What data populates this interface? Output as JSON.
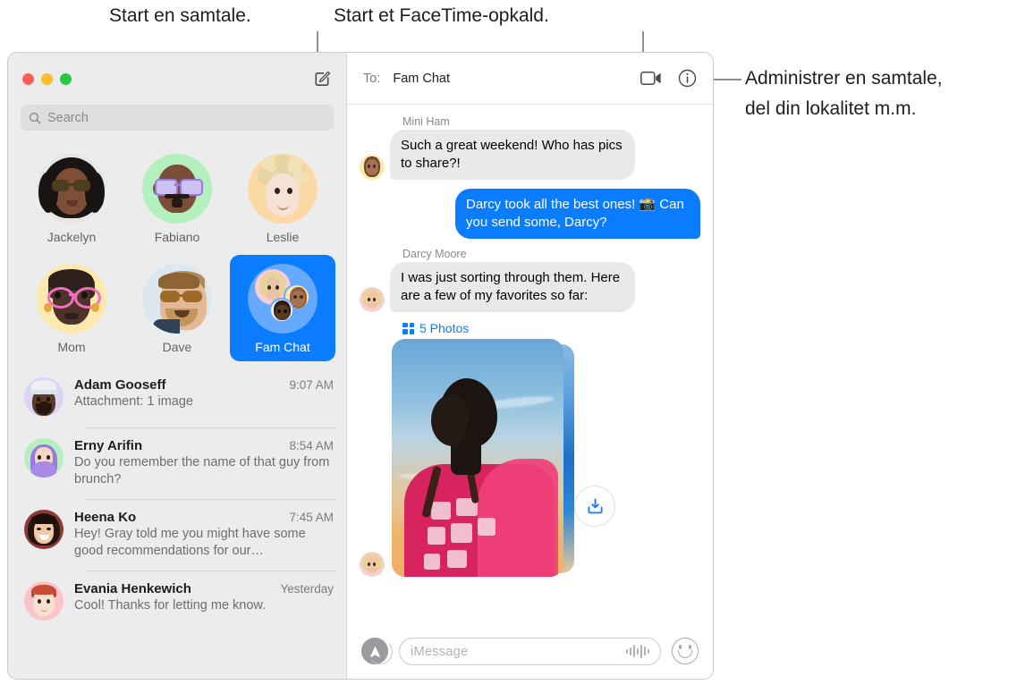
{
  "callouts": [
    {
      "id": "compose",
      "text": "Start en samtale."
    },
    {
      "id": "facetime",
      "text": "Start et FaceTime-opkald."
    },
    {
      "id": "details",
      "line1": "Administrer en samtale,",
      "line2": "del din lokalitet m.m."
    }
  ],
  "window": {
    "traffic_lights": [
      "close",
      "minimize",
      "zoom"
    ],
    "compose_icon": "compose-square-pencil-icon"
  },
  "sidebar": {
    "search": {
      "placeholder": "Search",
      "icon": "search-icon"
    },
    "pinned": [
      {
        "name": "Jackelyn",
        "selected": false
      },
      {
        "name": "Fabiano",
        "selected": false
      },
      {
        "name": "Leslie",
        "selected": false
      },
      {
        "name": "Mom",
        "selected": false
      },
      {
        "name": "Dave",
        "selected": false
      },
      {
        "name": "Fam Chat",
        "selected": true
      }
    ],
    "conversations": [
      {
        "name": "Adam Gooseff",
        "time": "9:07 AM",
        "preview": "Attachment: 1 image"
      },
      {
        "name": "Erny Arifin",
        "time": "8:54 AM",
        "preview": "Do you remember the name of that guy from brunch?"
      },
      {
        "name": "Heena Ko",
        "time": "7:45 AM",
        "preview": "Hey! Gray told me you might have some good recommendations for our…"
      },
      {
        "name": "Evania Henkewich",
        "time": "Yesterday",
        "preview": "Cool! Thanks for letting me know."
      }
    ]
  },
  "pane": {
    "to_label": "To:",
    "to_value": "Fam Chat",
    "facetime_icon": "video-camera-icon",
    "details_icon": "info-circle-icon",
    "messages": [
      {
        "sender": "Mini Ham",
        "direction": "in",
        "text": "Such a great weekend! Who has pics to share?!"
      },
      {
        "sender": "",
        "direction": "out",
        "text": "Darcy took all the best ones! 📸 Can you send some, Darcy?"
      },
      {
        "sender": "Darcy Moore",
        "direction": "in",
        "text": "I was just sorting through them. Here are a few of my favorites so far:"
      }
    ],
    "attachment": {
      "label": "5 Photos",
      "grid_icon": "grid-icon",
      "save_icon": "save-download-icon"
    },
    "composer": {
      "apps_icon": "app-store-icon",
      "placeholder": "iMessage",
      "audio_icon": "audio-waveform-icon",
      "emoji_icon": "smiley-face-icon"
    }
  },
  "colors": {
    "accent_blue": "#0a7cff",
    "bubble_in": "#e9e9eb",
    "sidebar_bg": "#ececec",
    "traffic_red": "#ff5f57",
    "traffic_yellow": "#febc2e",
    "traffic_green": "#28c840"
  }
}
